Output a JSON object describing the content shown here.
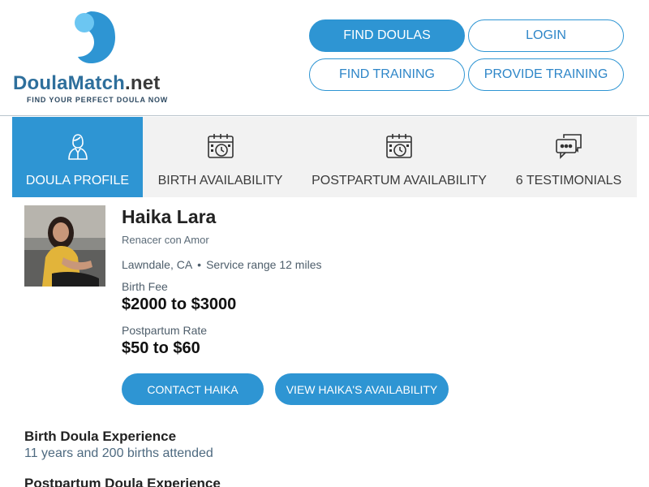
{
  "header": {
    "logo": {
      "brand_main": "DoulaMatch",
      "brand_suffix": ".net",
      "tagline": "FIND YOUR PERFECT DOULA NOW"
    },
    "nav": {
      "find_doulas": "FIND DOULAS",
      "login": "LOGIN",
      "find_training": "FIND TRAINING",
      "provide_training": "PROVIDE TRAINING"
    }
  },
  "tabs": [
    {
      "label": "DOULA PROFILE",
      "active": true
    },
    {
      "label": "BIRTH AVAILABILITY",
      "active": false
    },
    {
      "label": "POSTPARTUM AVAILABILITY",
      "active": false
    },
    {
      "label": "6 TESTIMONIALS",
      "active": false
    }
  ],
  "profile": {
    "name": "Haika Lara",
    "business": "Renacer con Amor",
    "city": "Lawndale, CA",
    "service_range": "Service range 12 miles",
    "birth_fee_label": "Birth Fee",
    "birth_fee": "$2000 to $3000",
    "postpartum_label": "Postpartum Rate",
    "postpartum_rate": "$50 to $60",
    "contact_label": "CONTACT HAIKA",
    "availability_label": "VIEW HAIKA'S AVAILABILITY"
  },
  "sections": {
    "birth_title": "Birth Doula Experience",
    "birth_text": "11 years and 200 births attended",
    "postpartum_title": "Postpartum Doula Experience"
  },
  "colors": {
    "accent": "#2e95d3",
    "tab_bg": "#f2f2f2",
    "brand_blue": "#2e6f9c"
  }
}
